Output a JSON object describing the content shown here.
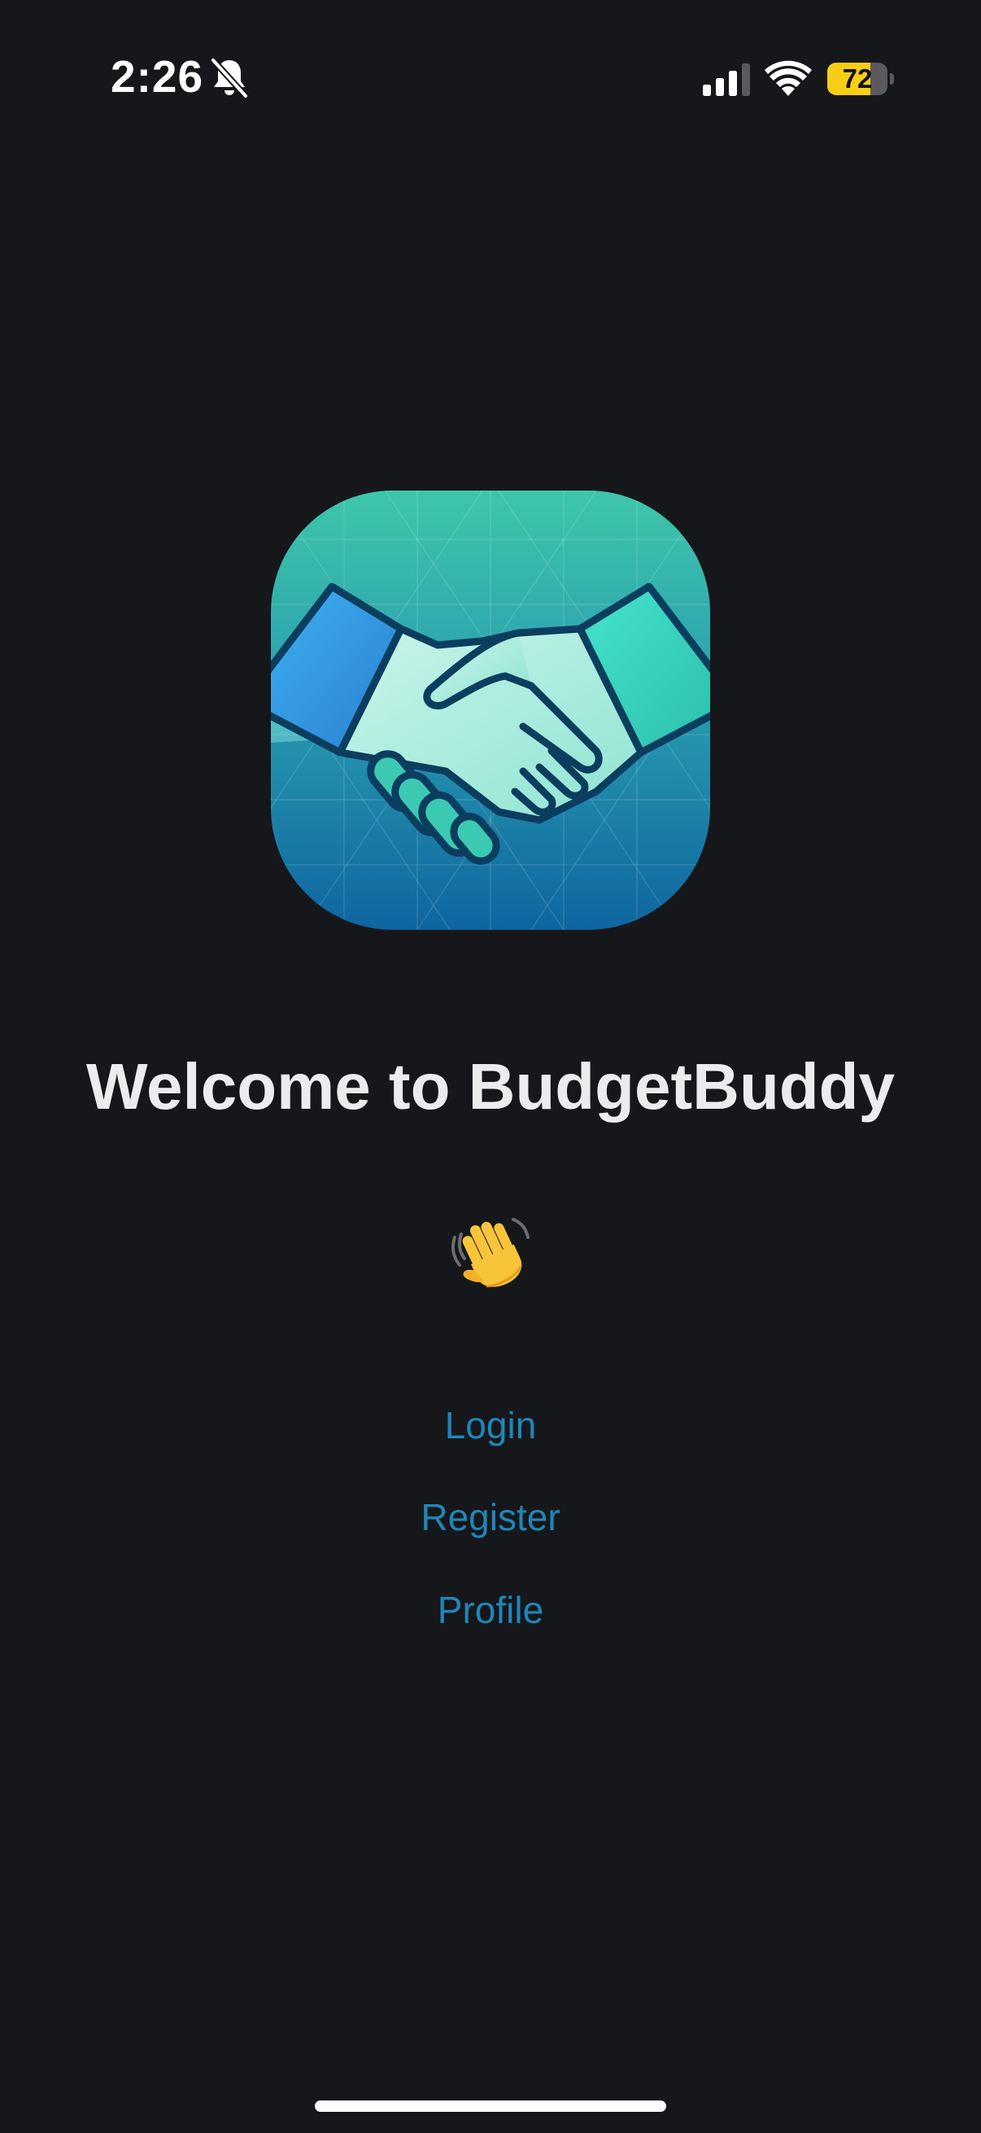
{
  "status_bar": {
    "time": "2:26",
    "battery_level": "72",
    "battery_fraction": 0.72,
    "icons": [
      "bell-slash-icon",
      "cellular-signal-icon",
      "wifi-icon",
      "battery-icon"
    ]
  },
  "logo": {
    "icon": "handshake-icon",
    "colors": {
      "gradient_top": "#3fc6a9",
      "gradient_bottom": "#0f65a0",
      "outline": "#0b3d5e"
    }
  },
  "welcome": {
    "title": "Welcome to BudgetBuddy",
    "emoji_icon": "waving-hand-icon"
  },
  "nav": {
    "login": "Login",
    "register": "Register",
    "profile": "Profile"
  },
  "colors": {
    "background": "#16171a",
    "title": "#ececee",
    "link": "#1f86b8",
    "battery": "#f7ce15"
  }
}
